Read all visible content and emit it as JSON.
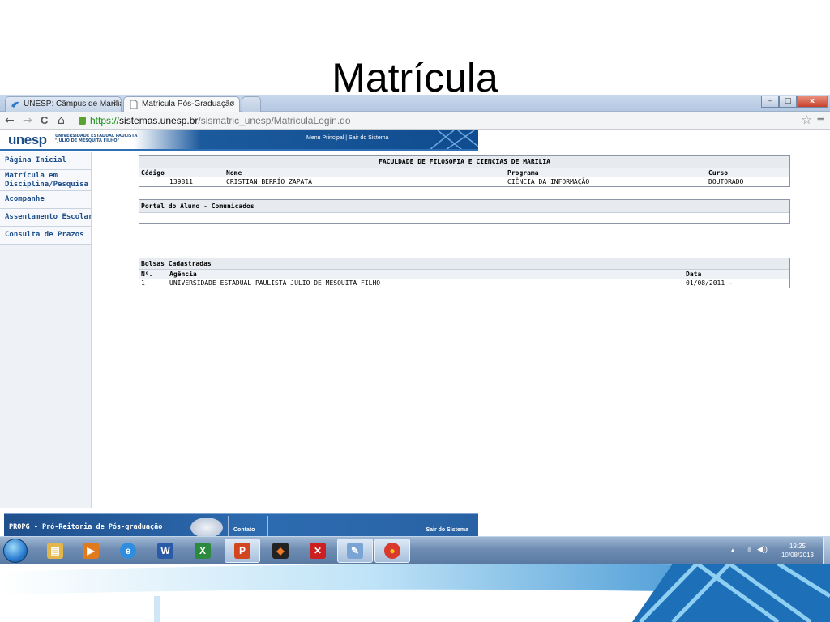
{
  "slide": {
    "title": "Matrícula"
  },
  "browser": {
    "tabs": [
      {
        "label": "UNESP: Câmpus de Marília",
        "active": false
      },
      {
        "label": "Matrícula Pós-Graduação",
        "active": true
      }
    ],
    "tab_close": "×",
    "url": {
      "scheme": "https://",
      "host": "sistemas.unesp.br",
      "path": "/sismatric_unesp/MatriculaLogin.do"
    },
    "nav": {
      "back": "←",
      "forward": "→",
      "reload": "C",
      "home": "⌂"
    },
    "bookmark_star": "☆",
    "menu_icon": "≡",
    "window_buttons": {
      "minimize": "–",
      "maximize": "□",
      "close": "x"
    }
  },
  "site": {
    "logo": "unesp",
    "logo_sub_line1": "UNIVERSIDADE ESTADUAL PAULISTA",
    "logo_sub_line2": "\"JÚLIO DE MESQUITA FILHO\"",
    "header_links": {
      "menu_principal": "Menu Principal",
      "separator": " | ",
      "sair": "Sair do Sistema"
    },
    "sidebar": [
      {
        "label": "Página Inicial",
        "type": "single"
      },
      {
        "label": "Matrícula em Disciplina/Pesquisa",
        "type": "double"
      },
      {
        "label": "Acompanhe",
        "type": "single"
      },
      {
        "label": "Assentamento Escolar",
        "type": "single"
      },
      {
        "label": "Consulta de Prazos",
        "type": "single"
      }
    ],
    "student": {
      "faculty": "FACULDADE DE FILOSOFIA E CIENCIAS DE MARILIA",
      "headers": {
        "codigo": "Código",
        "nome": "Nome",
        "programa": "Programa",
        "curso": "Curso"
      },
      "codigo": "139811",
      "nome": "CRISTIAN BERRÍO ZAPATA",
      "programa": "CIÊNCIA DA INFORMAÇÃO",
      "curso": "DOUTORADO"
    },
    "portal": {
      "title": "Portal do Aluno - Comunicados"
    },
    "bolsas": {
      "title": "Bolsas Cadastradas",
      "headers": {
        "numero": "Nº.",
        "agencia": "Agência",
        "data": "Data"
      },
      "rows": [
        {
          "numero": "1",
          "agencia": "UNIVERSIDADE ESTADUAL PAULISTA JULIO DE MESQUITA FILHO",
          "data": "01/08/2011 -"
        }
      ]
    },
    "footer": {
      "title": "PROPG - Pró-Reitoria de Pós-graduação",
      "contato": "Contato",
      "sair": "Sair do Sistema"
    }
  },
  "taskbar": {
    "apps": [
      {
        "name": "explorer",
        "glyph": "▤",
        "color": "#e2b64a"
      },
      {
        "name": "media-player",
        "glyph": "▶",
        "color": "#e07a1d"
      },
      {
        "name": "internet-explorer",
        "glyph": "e",
        "color": "#2f8de0"
      },
      {
        "name": "word",
        "glyph": "W",
        "color": "#2a5aa8"
      },
      {
        "name": "excel",
        "glyph": "X",
        "color": "#2b8a3e"
      },
      {
        "name": "powerpoint",
        "glyph": "P",
        "color": "#d2471f"
      },
      {
        "name": "app-black",
        "glyph": "◆",
        "color": "#222222"
      },
      {
        "name": "acrobat",
        "glyph": "✕",
        "color": "#cc1f1f"
      },
      {
        "name": "paint",
        "glyph": "✎",
        "color": "#7aa4d6"
      },
      {
        "name": "chrome",
        "glyph": "●",
        "color": "#d93a2c"
      }
    ],
    "tray_arrow": "▲",
    "tray_network": ".ıll",
    "tray_volume": "◀))",
    "time": "19:25",
    "date": "10/08/2013"
  }
}
